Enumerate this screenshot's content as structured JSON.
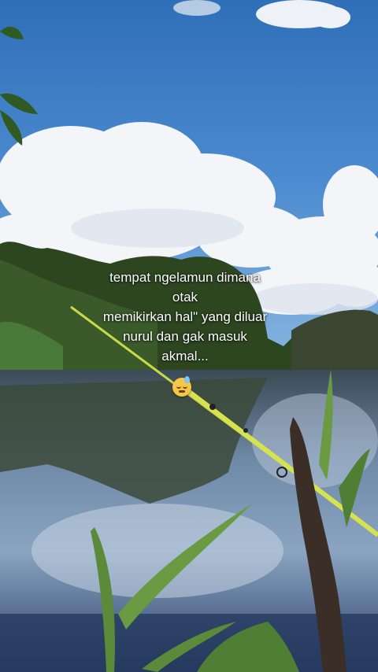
{
  "caption": {
    "lines": [
      "tempat ngelamun dimana",
      "otak",
      "memikirkan hal\" yang diluar",
      "nurul dan gak masuk",
      "akmal..."
    ],
    "emoji": "sleepy-face-icon"
  },
  "colors": {
    "sky": "#3f7fc4",
    "cloud": "#f2f4f7",
    "trees": "#2f4a25",
    "water": "#2a3a4c",
    "rod": "#c8d84a"
  }
}
